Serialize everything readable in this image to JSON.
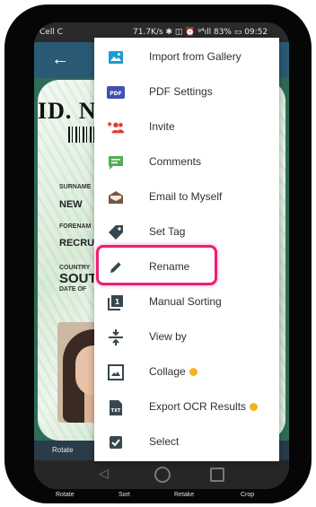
{
  "status_bar": {
    "carrier": "Cell C",
    "indicators": "71.7K/s ✱ ◫ ⏰ ᵍ⁴ıll 83% ▭ 09:52"
  },
  "app_bar": {
    "back_icon": "arrow-left-icon"
  },
  "card": {
    "title": "ID. N",
    "labels": {
      "surname": "SURNAME",
      "forenames": "FORENAM",
      "country": "COUNTRY",
      "date_of_birth": "DATE OF"
    },
    "values": {
      "surname": "NEW",
      "forenames": "RECRU",
      "country": "SOUT"
    }
  },
  "bottom_bar": {
    "rotate": "Rotate",
    "more": "···"
  },
  "menu": {
    "items": [
      {
        "label": "Import from Gallery",
        "icon": "gallery-icon",
        "color": "#1a9bd7",
        "badge": false
      },
      {
        "label": "PDF Settings",
        "icon": "pdf-icon",
        "color": "#3f51b5",
        "badge": false
      },
      {
        "label": "Invite",
        "icon": "add-people-icon",
        "color": "#e53935",
        "badge": false
      },
      {
        "label": "Comments",
        "icon": "comment-icon",
        "color": "#4caf50",
        "badge": false
      },
      {
        "label": "Email to Myself",
        "icon": "email-icon",
        "color": "#795548",
        "badge": false
      },
      {
        "label": "Set Tag",
        "icon": "tag-icon",
        "color": "#37474f",
        "badge": false
      },
      {
        "label": "Rename",
        "icon": "pencil-icon",
        "color": "#37474f",
        "badge": false
      },
      {
        "label": "Manual Sorting",
        "icon": "sort-icon",
        "color": "#37474f",
        "badge": false
      },
      {
        "label": "View by",
        "icon": "view-by-icon",
        "color": "#37474f",
        "badge": false
      },
      {
        "label": "Collage",
        "icon": "collage-icon",
        "color": "#37474f",
        "badge": true
      },
      {
        "label": "Export OCR Results",
        "icon": "txt-file-icon",
        "color": "#37474f",
        "badge": true
      },
      {
        "label": "Select",
        "icon": "checkbox-icon",
        "color": "#37474f",
        "badge": false
      }
    ],
    "highlighted": "Rename",
    "highlight_color": "#ec1e72",
    "badge_color": "#f5b21b"
  },
  "reflection_labels": [
    "Rotate",
    "Sort",
    "Retake",
    "Crop"
  ]
}
